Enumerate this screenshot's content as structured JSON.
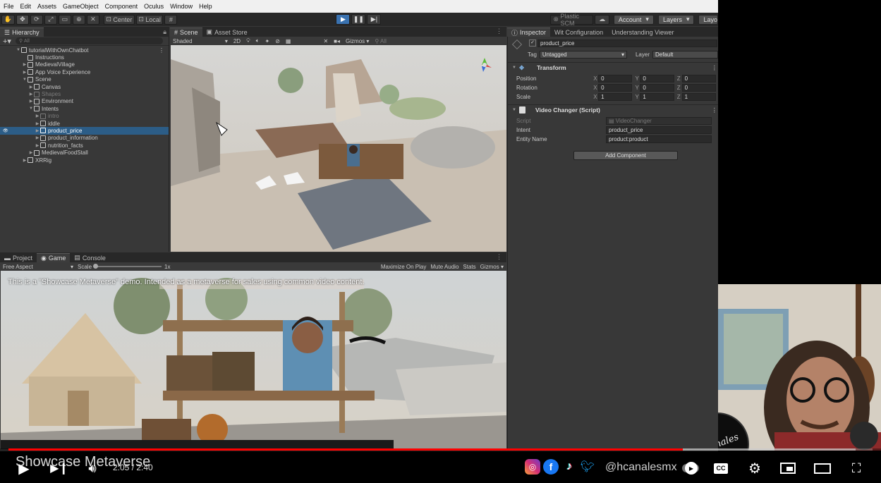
{
  "menu": [
    "File",
    "Edit",
    "Assets",
    "GameObject",
    "Component",
    "Oculus",
    "Window",
    "Help"
  ],
  "toolbar": {
    "center_label": "Center",
    "local_label": "Local",
    "plastic_label": "Plastic SCM",
    "account_label": "Account",
    "layers_label": "Layers",
    "layout_label": "Layo"
  },
  "hierarchy": {
    "tab": "Hierarchy",
    "search_placeholder": "All",
    "rows": [
      {
        "label": "tutorialWithOwnChatbot",
        "depth": 0,
        "tri": "▼",
        "state": "root"
      },
      {
        "label": "Instructions",
        "depth": 1,
        "tri": "",
        "state": "normal"
      },
      {
        "label": "MedievalVillage",
        "depth": 1,
        "tri": "▶",
        "state": "normal"
      },
      {
        "label": "App Voice Experience",
        "depth": 1,
        "tri": "▶",
        "state": "normal"
      },
      {
        "label": "Scene",
        "depth": 1,
        "tri": "▼",
        "state": "normal"
      },
      {
        "label": "Canvas",
        "depth": 2,
        "tri": "▶",
        "state": "normal"
      },
      {
        "label": "Shapes",
        "depth": 2,
        "tri": "▶",
        "state": "dim"
      },
      {
        "label": "Environment",
        "depth": 2,
        "tri": "▶",
        "state": "normal"
      },
      {
        "label": "Intents",
        "depth": 2,
        "tri": "▼",
        "state": "normal"
      },
      {
        "label": "intro",
        "depth": 3,
        "tri": "▶",
        "state": "dim"
      },
      {
        "label": "iddle",
        "depth": 3,
        "tri": "▶",
        "state": "normal"
      },
      {
        "label": "product_price",
        "depth": 3,
        "tri": "▶",
        "state": "selected"
      },
      {
        "label": "product_information",
        "depth": 3,
        "tri": "▶",
        "state": "normal"
      },
      {
        "label": "nutrition_facts",
        "depth": 3,
        "tri": "▶",
        "state": "normal"
      },
      {
        "label": "MedievalFoodStall",
        "depth": 2,
        "tri": "▶",
        "state": "normal"
      },
      {
        "label": "XRRig",
        "depth": 1,
        "tri": "▶",
        "state": "normal"
      }
    ]
  },
  "scene": {
    "tabs": [
      "Scene",
      "Asset Store"
    ],
    "shading": "Shaded",
    "twod": "2D",
    "gizmos": "Gizmos",
    "search_placeholder": "All"
  },
  "inspector": {
    "tabs": [
      "Inspector",
      "Wit Configuration",
      "Understanding Viewer"
    ],
    "object_name": "product_price",
    "tag_label": "Tag",
    "tag_value": "Untagged",
    "layer_label": "Layer",
    "layer_value": "Default",
    "transform": {
      "header": "Transform",
      "rows": [
        {
          "label": "Position",
          "x": "0",
          "y": "0",
          "z": "0"
        },
        {
          "label": "Rotation",
          "x": "0",
          "y": "0",
          "z": "0"
        },
        {
          "label": "Scale",
          "x": "1",
          "y": "1",
          "z": "1"
        }
      ]
    },
    "video_changer": {
      "header": "Video Changer (Script)",
      "script_label": "Script",
      "script_value": "VideoChanger",
      "intent_label": "Intent",
      "intent_value": "product_price",
      "entity_label": "Entity Name",
      "entity_value": "product:product"
    },
    "add_component": "Add Component"
  },
  "bottom": {
    "tabs": [
      "Project",
      "Game",
      "Console"
    ],
    "aspect": "Free Aspect",
    "scale_label": "Scale",
    "scale_value": "1x",
    "toggles": [
      "Maximize On Play",
      "Mute Audio",
      "Stats",
      "Gizmos"
    ]
  },
  "game_view": {
    "caption": "This is a \"Showcase Metaverse\" demo. Intended as a metaverse for sales using common video content."
  },
  "youtube": {
    "title": "Showcase Metaverse",
    "time": "2:05 / 2:40",
    "progress": 0.78,
    "buffered": 0.98,
    "handle": "@hcanalesmx",
    "watermark": "HCanales"
  },
  "colors": {
    "progress": "#ff0000",
    "selection": "#2c5d87",
    "play_active": "#3a72b0",
    "editor_bg": "#383838"
  }
}
